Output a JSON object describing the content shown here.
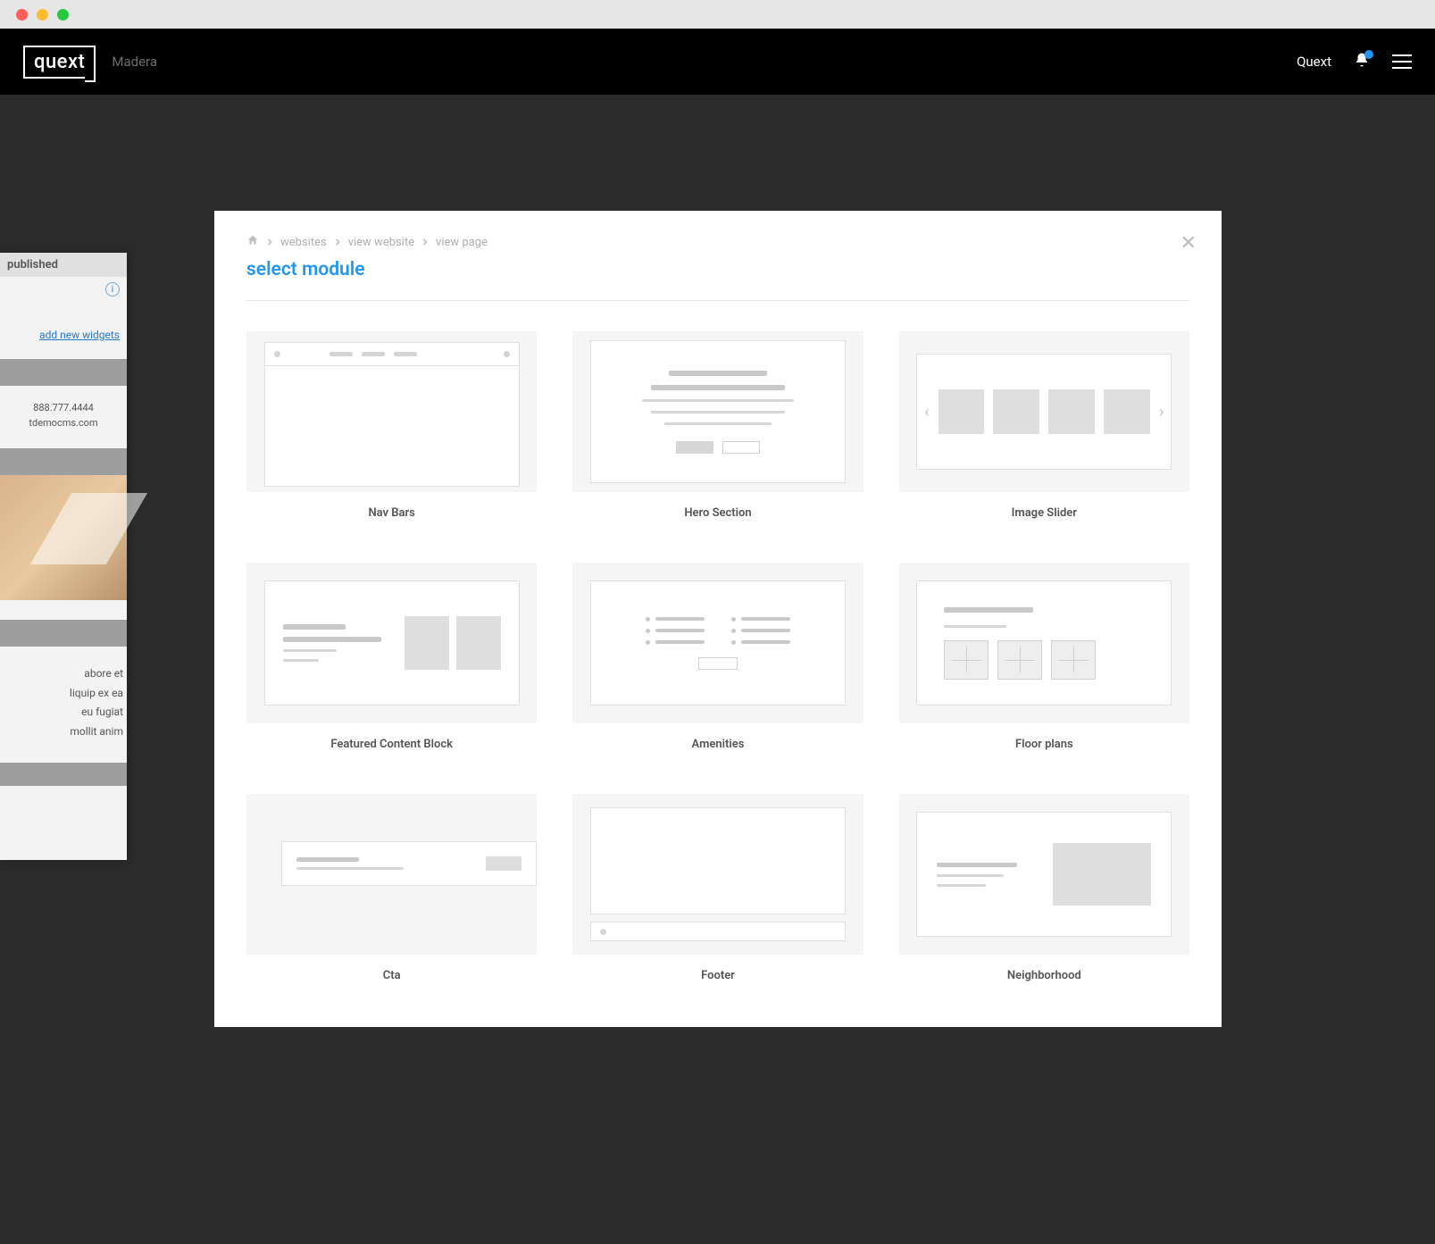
{
  "header": {
    "logo_text": "quext",
    "subbrand": "Madera",
    "right_link": "Quext"
  },
  "behind": {
    "status": "published",
    "add_widgets": "add new widgets",
    "phone": "888.777.4444",
    "domain": "tdemocms.com",
    "lorem1": "abore et",
    "lorem2": "liquip ex ea",
    "lorem3": "eu fugiat",
    "lorem4": "mollit anim"
  },
  "modal": {
    "title": "select module",
    "breadcrumbs": [
      "websites",
      "view website",
      "view page"
    ],
    "cards": [
      {
        "label": "Nav Bars"
      },
      {
        "label": "Hero Section"
      },
      {
        "label": "Image Slider"
      },
      {
        "label": "Featured Content Block"
      },
      {
        "label": "Amenities"
      },
      {
        "label": "Floor plans"
      },
      {
        "label": "Cta"
      },
      {
        "label": "Footer"
      },
      {
        "label": "Neighborhood"
      }
    ]
  }
}
